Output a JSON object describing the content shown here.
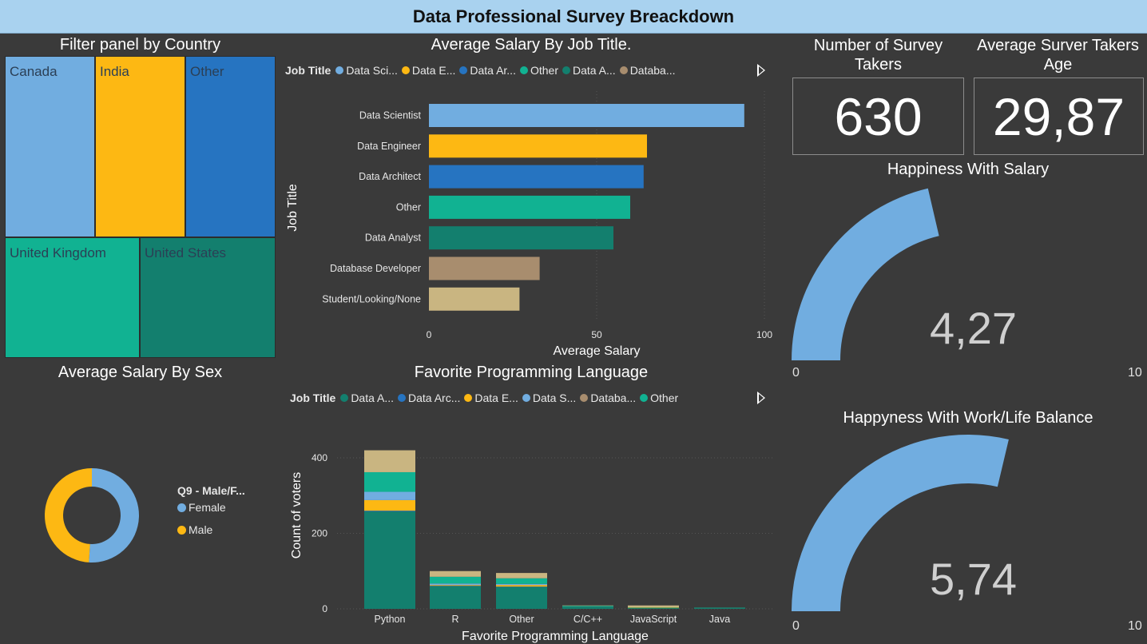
{
  "header": {
    "title": "Data Professional Survey Breackdown"
  },
  "treemap": {
    "title": "Filter panel by Country",
    "tiles": [
      {
        "label": "Canada",
        "color": "#71ade0"
      },
      {
        "label": "India",
        "color": "#fdb813"
      },
      {
        "label": "Other",
        "color": "#2674c1"
      },
      {
        "label": "United Kingdom",
        "color": "#11b292"
      },
      {
        "label": "United States",
        "color": "#137f6e"
      }
    ]
  },
  "salary_by_job": {
    "title": "Average Salary By Job Title.",
    "legend_title": "Job Title",
    "legend": [
      {
        "label": "Data Sci...",
        "color": "#71ade0"
      },
      {
        "label": "Data E...",
        "color": "#fdb813"
      },
      {
        "label": "Data Ar...",
        "color": "#2674c1"
      },
      {
        "label": "Other",
        "color": "#11b292"
      },
      {
        "label": "Data A...",
        "color": "#137f6e"
      },
      {
        "label": "Databa...",
        "color": "#a88d6e"
      }
    ]
  },
  "cards": {
    "survey_takers": {
      "title": "Number of Survey Takers",
      "value": "630"
    },
    "avg_age": {
      "title": "Average Surver Takers Age",
      "value": "29,87"
    }
  },
  "gauge_salary": {
    "title": "Happiness With Salary",
    "value": "4,27",
    "min": "0",
    "max": "10",
    "fraction": 0.427,
    "color": "#71ade0"
  },
  "gauge_balance": {
    "title": "Happyness With Work/Life Balance",
    "value": "5,74",
    "min": "0",
    "max": "10",
    "fraction": 0.574,
    "color": "#71ade0"
  },
  "salary_by_sex": {
    "title": "Average Salary By Sex",
    "legend_title": "Q9 - Male/F...",
    "items": [
      {
        "label": "Female",
        "color": "#71ade0"
      },
      {
        "label": "Male",
        "color": "#fdb813"
      }
    ]
  },
  "language": {
    "title": "Favorite Programming Language",
    "legend_title": "Job Title",
    "legend": [
      {
        "label": "Data A...",
        "color": "#137f6e"
      },
      {
        "label": "Data Arc...",
        "color": "#2674c1"
      },
      {
        "label": "Data E...",
        "color": "#fdb813"
      },
      {
        "label": "Data S...",
        "color": "#71ade0"
      },
      {
        "label": "Databa...",
        "color": "#a88d6e"
      },
      {
        "label": "Other",
        "color": "#11b292"
      }
    ]
  },
  "chart_data": [
    {
      "type": "bar",
      "orientation": "horizontal",
      "title": "Average Salary By Job Title.",
      "xlabel": "Average Salary",
      "ylabel": "Job Title",
      "xlim": [
        0,
        100
      ],
      "xticks": [
        "0",
        "50",
        "100"
      ],
      "categories": [
        "Data Scientist",
        "Data Engineer",
        "Data Architect",
        "Other",
        "Data Analyst",
        "Database Developer",
        "Student/Looking/None"
      ],
      "values": [
        94,
        65,
        64,
        60,
        55,
        33,
        27
      ],
      "colors": [
        "#71ade0",
        "#fdb813",
        "#2674c1",
        "#11b292",
        "#137f6e",
        "#a88d6e",
        "#c9b581"
      ]
    },
    {
      "type": "bar",
      "stacked": true,
      "title": "Favorite Programming Language",
      "xlabel": "Favorite Programming Language",
      "ylabel": "Count of voters",
      "ylim": [
        0,
        440
      ],
      "yticks": [
        "0",
        "200",
        "400"
      ],
      "categories": [
        "Python",
        "R",
        "Other",
        "C/C++",
        "JavaScript",
        "Java"
      ],
      "series": [
        {
          "name": "Data A...",
          "color": "#137f6e",
          "values": [
            258,
            60,
            58,
            6,
            2,
            2
          ]
        },
        {
          "name": "Data Arc...",
          "color": "#2674c1",
          "values": [
            2,
            1,
            1,
            0,
            0,
            0
          ]
        },
        {
          "name": "Data E...",
          "color": "#fdb813",
          "values": [
            28,
            2,
            4,
            0,
            1,
            0
          ]
        },
        {
          "name": "Data S...",
          "color": "#71ade0",
          "values": [
            22,
            4,
            3,
            0,
            0,
            0
          ]
        },
        {
          "name": "Other",
          "color": "#11b292",
          "values": [
            52,
            18,
            15,
            2,
            1,
            1
          ]
        },
        {
          "name": "Databa...",
          "color": "#c9b581",
          "values": [
            58,
            15,
            14,
            1,
            5,
            0
          ]
        }
      ]
    },
    {
      "type": "pie",
      "donut": true,
      "title": "Average Salary By Sex",
      "categories": [
        "Female",
        "Male"
      ],
      "values": [
        51,
        49
      ],
      "colors": [
        "#71ade0",
        "#fdb813"
      ]
    }
  ]
}
